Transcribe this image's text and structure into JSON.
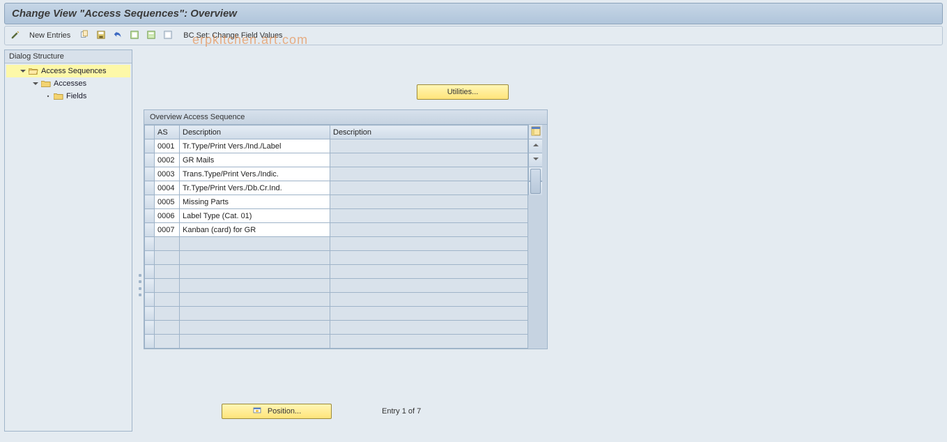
{
  "title": "Change View \"Access Sequences\": Overview",
  "toolbar": {
    "new_entries": "New Entries",
    "bc_text": "BC Set: Change Field Values",
    "icons": {
      "pencil": "pencil-icon",
      "copy": "copy-icon",
      "save": "save-icon",
      "undo": "undo-icon",
      "select_all": "select-all-icon",
      "select_block": "select-block-icon",
      "deselect": "deselect-icon"
    }
  },
  "tree": {
    "header": "Dialog Structure",
    "nodes": {
      "root": {
        "label": "Access Sequences",
        "open": true,
        "selected": true
      },
      "child1": {
        "label": "Accesses"
      },
      "child2": {
        "label": "Fields"
      }
    }
  },
  "utilities_label": "Utilities...",
  "table": {
    "caption": "Overview Access Sequence",
    "columns": {
      "as": "AS",
      "desc1": "Description",
      "desc2": "Description"
    },
    "rows": [
      {
        "as": "0001",
        "desc1": "Tr.Type/Print Vers./Ind./Label",
        "desc2": ""
      },
      {
        "as": "0002",
        "desc1": "GR Mails",
        "desc2": ""
      },
      {
        "as": "0003",
        "desc1": "Trans.Type/Print Vers./Indic.",
        "desc2": ""
      },
      {
        "as": "0004",
        "desc1": "Tr.Type/Print Vers./Db.Cr.Ind.",
        "desc2": ""
      },
      {
        "as": "0005",
        "desc1": "Missing Parts",
        "desc2": ""
      },
      {
        "as": "0006",
        "desc1": "Label Type (Cat. 01)",
        "desc2": ""
      },
      {
        "as": "0007",
        "desc1": "Kanban (card) for GR",
        "desc2": ""
      }
    ],
    "empty_row_count": 8
  },
  "footer": {
    "position_label": "Position...",
    "entry_text": "Entry 1 of 7"
  }
}
